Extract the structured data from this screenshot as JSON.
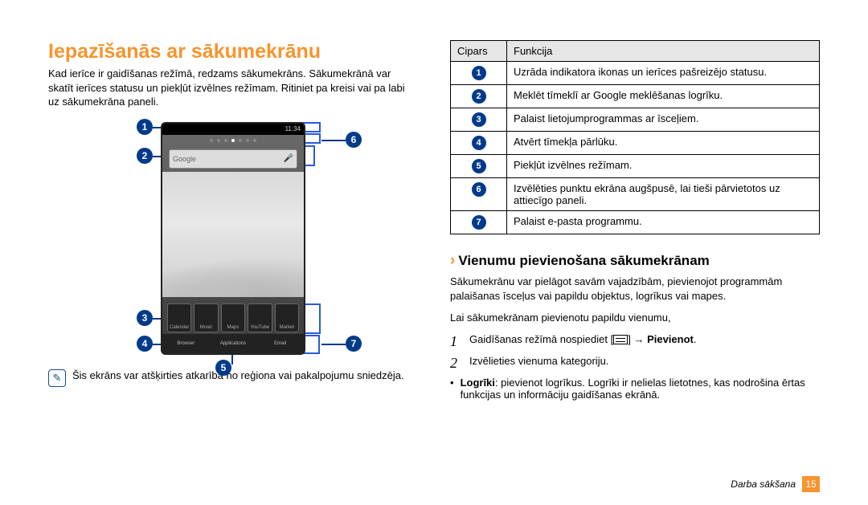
{
  "left": {
    "title": "Iepazīšanās ar sākumekrānu",
    "intro": "Kad ierīce ir gaidīšanas režīmā, redzams sākumekrāns. Sākumekrānā var skatīt ierīces statusu un piekļūt izvēlnes režīmam. Ritiniet pa kreisi vai pa labi uz sākumekrāna paneli.",
    "note": "Šis ekrāns var atšķirties atkarībā no reģiona vai pakalpojumu sniedzēja.",
    "callouts": [
      "1",
      "2",
      "3",
      "4",
      "5",
      "6",
      "7"
    ],
    "device": {
      "clock": "11:34",
      "search_placeholder": "Google",
      "row1": [
        "Calendar",
        "Music",
        "Maps",
        "YouTube",
        "Market"
      ],
      "row2": [
        "Browser",
        "Applications",
        "Email"
      ]
    }
  },
  "table": {
    "head_num": "Cipars",
    "head_func": "Funkcija",
    "rows": [
      {
        "n": "1",
        "f": "Uzrāda indikatora ikonas un ierīces pašreizējo statusu."
      },
      {
        "n": "2",
        "f": "Meklēt tīmeklī ar Google meklēšanas logrīku."
      },
      {
        "n": "3",
        "f": "Palaist lietojumprogrammas ar īsceļiem."
      },
      {
        "n": "4",
        "f": "Atvērt tīmekļa pārlūku."
      },
      {
        "n": "5",
        "f": "Piekļūt izvēlnes režīmam."
      },
      {
        "n": "6",
        "f": "Izvēlēties punktu ekrāna augšpusē, lai tieši pārvietotos uz attiecīgo paneli."
      },
      {
        "n": "7",
        "f": "Palaist e-pasta programmu."
      }
    ]
  },
  "sub": {
    "title": "Vienumu pievienošana sākumekrānam",
    "p1": "Sākumekrānu var pielāgot savām vajadzībām, pievienojot programmām palaišanas īsceļus vai papildu objektus, logrīkus vai mapes.",
    "p2": "Lai sākumekrānam pievienotu papildu vienumu,",
    "step1a": "Gaidīšanas režīmā nospiediet [",
    "step1b": "] → ",
    "step1c": "Pievienot",
    "step1d": ".",
    "step2": "Izvēlieties vienuma kategoriju.",
    "bullet_label": "Logrīki",
    "bullet_text": ": pievienot logrīkus. Logrīki ir nelielas lietotnes, kas nodrošina ērtas funkcijas un informāciju gaidīšanas ekrānā."
  },
  "footer": {
    "section": "Darba sākšana",
    "page": "15"
  }
}
